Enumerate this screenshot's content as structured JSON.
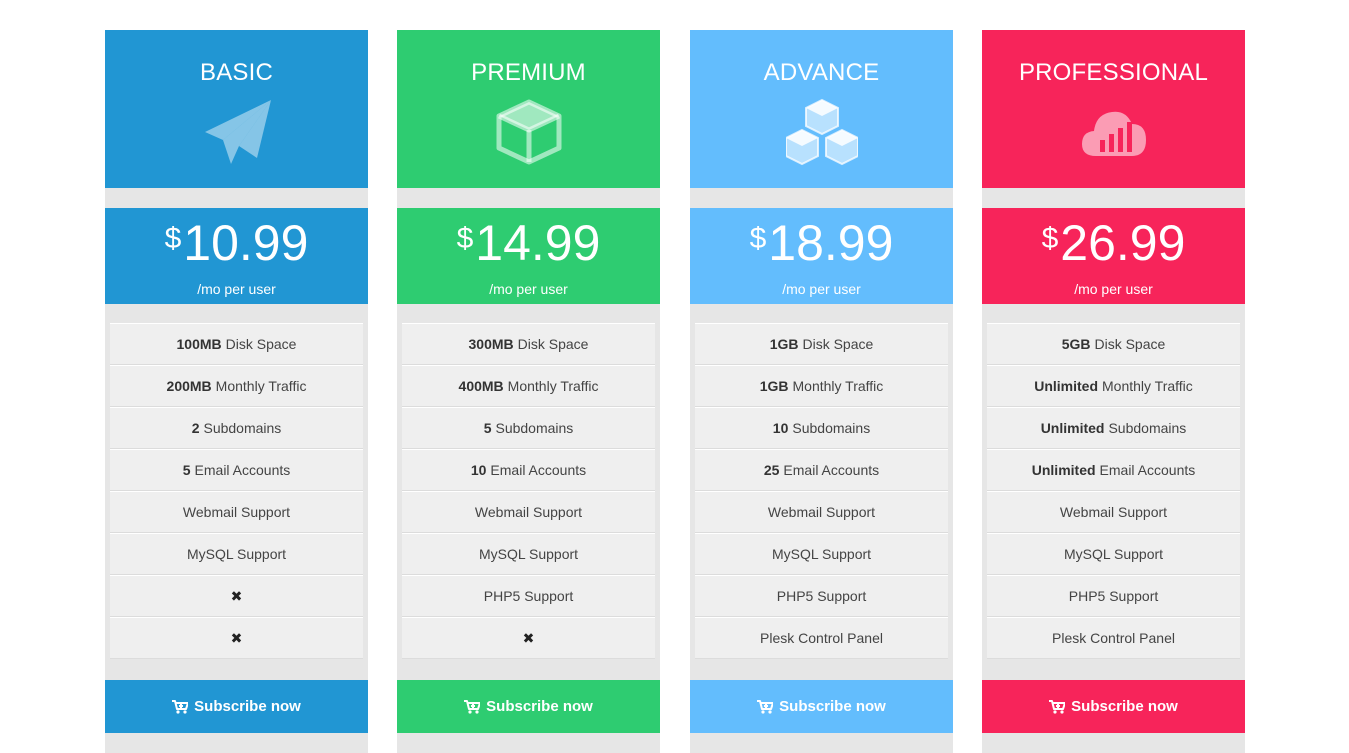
{
  "plans": [
    {
      "name": "BASIC",
      "color": "#2196d3",
      "icon": "paper-plane-icon",
      "currency": "$",
      "price": "10.99",
      "period": "/mo per user",
      "features": [
        {
          "strong": "100MB",
          "text": "Disk Space"
        },
        {
          "strong": "200MB",
          "text": "Monthly Traffic"
        },
        {
          "strong": "2",
          "text": "Subdomains"
        },
        {
          "strong": "5",
          "text": "Email Accounts"
        },
        {
          "strong": "",
          "text": "Webmail Support"
        },
        {
          "strong": "",
          "text": "MySQL Support"
        },
        {
          "strong": "",
          "text": "",
          "x": true
        },
        {
          "strong": "",
          "text": "",
          "x": true
        }
      ],
      "cta": "Subscribe now"
    },
    {
      "name": "PREMIUM",
      "color": "#2ecc71",
      "icon": "cube-icon",
      "currency": "$",
      "price": "14.99",
      "period": "/mo per user",
      "features": [
        {
          "strong": "300MB",
          "text": "Disk Space"
        },
        {
          "strong": "400MB",
          "text": "Monthly Traffic"
        },
        {
          "strong": "5",
          "text": "Subdomains"
        },
        {
          "strong": "10",
          "text": "Email Accounts"
        },
        {
          "strong": "",
          "text": "Webmail Support"
        },
        {
          "strong": "",
          "text": "MySQL Support"
        },
        {
          "strong": "",
          "text": "PHP5 Support"
        },
        {
          "strong": "",
          "text": "",
          "x": true
        }
      ],
      "cta": "Subscribe now"
    },
    {
      "name": "ADVANCE",
      "color": "#63bdfd",
      "icon": "cubes-icon",
      "currency": "$",
      "price": "18.99",
      "period": "/mo per user",
      "features": [
        {
          "strong": "1GB",
          "text": "Disk Space"
        },
        {
          "strong": "1GB",
          "text": "Monthly Traffic"
        },
        {
          "strong": "10",
          "text": "Subdomains"
        },
        {
          "strong": "25",
          "text": "Email Accounts"
        },
        {
          "strong": "",
          "text": "Webmail Support"
        },
        {
          "strong": "",
          "text": "MySQL Support"
        },
        {
          "strong": "",
          "text": "PHP5 Support"
        },
        {
          "strong": "",
          "text": "Plesk Control Panel"
        }
      ],
      "cta": "Subscribe now"
    },
    {
      "name": "PROFESSIONAL",
      "color": "#f7245a",
      "icon": "cloud-chart-icon",
      "currency": "$",
      "price": "26.99",
      "period": "/mo per user",
      "features": [
        {
          "strong": "5GB",
          "text": "Disk Space"
        },
        {
          "strong": "Unlimited",
          "text": "Monthly Traffic"
        },
        {
          "strong": "Unlimited",
          "text": "Subdomains"
        },
        {
          "strong": "Unlimited",
          "text": "Email Accounts"
        },
        {
          "strong": "",
          "text": "Webmail Support"
        },
        {
          "strong": "",
          "text": "MySQL Support"
        },
        {
          "strong": "",
          "text": "PHP5 Support"
        },
        {
          "strong": "",
          "text": "Plesk Control Panel"
        }
      ],
      "cta": "Subscribe now"
    }
  ],
  "x_glyph": "✖"
}
